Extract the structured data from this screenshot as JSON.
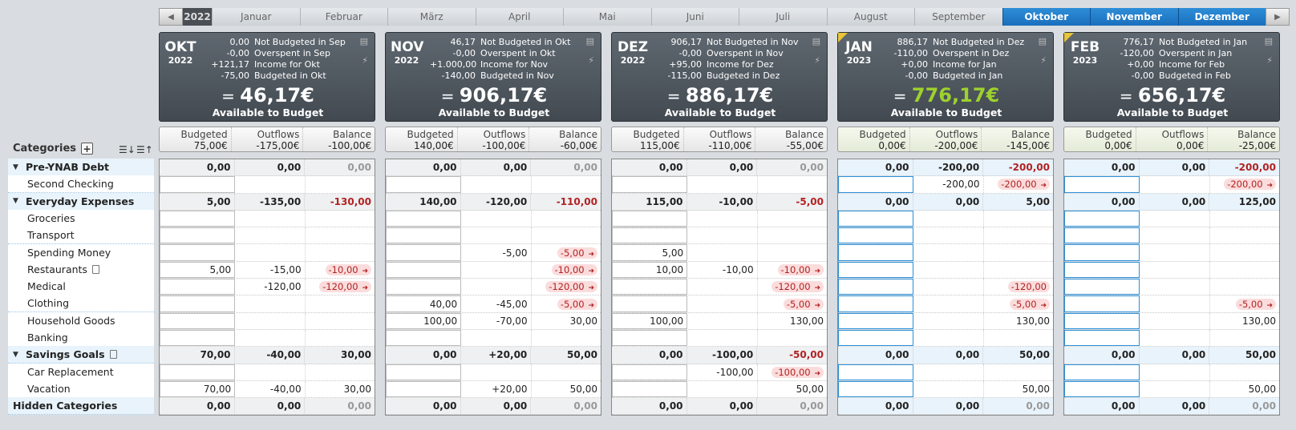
{
  "nav": {
    "prev_icon": "◀",
    "next_icon": "▶",
    "year": "2022",
    "months": [
      {
        "label": "Januar",
        "active": false
      },
      {
        "label": "Februar",
        "active": false
      },
      {
        "label": "März",
        "active": false
      },
      {
        "label": "April",
        "active": false
      },
      {
        "label": "Mai",
        "active": false
      },
      {
        "label": "Juni",
        "active": false
      },
      {
        "label": "Juli",
        "active": false
      },
      {
        "label": "August",
        "active": false
      },
      {
        "label": "September",
        "active": false
      },
      {
        "label": "Oktober",
        "active": true
      },
      {
        "label": "November",
        "active": true
      },
      {
        "label": "Dezember",
        "active": true
      }
    ]
  },
  "sidebar": {
    "title": "Categories",
    "add_icon": "+",
    "sort_icon_1": "☰↓",
    "sort_icon_2": "☰↑",
    "rows": [
      {
        "label": "Pre-YNAB Debt",
        "type": "grp"
      },
      {
        "label": "Second Checking",
        "type": "sub"
      },
      {
        "label": "Everyday Expenses",
        "type": "grp"
      },
      {
        "label": "Groceries",
        "type": "sub"
      },
      {
        "label": "Transport",
        "type": "sub"
      },
      {
        "label": "Spending Money",
        "type": "sub"
      },
      {
        "label": "Restaurants",
        "type": "sub",
        "note": true
      },
      {
        "label": "Medical",
        "type": "sub"
      },
      {
        "label": "Clothing",
        "type": "sub"
      },
      {
        "label": "Household Goods",
        "type": "sub"
      },
      {
        "label": "Banking",
        "type": "sub"
      },
      {
        "label": "Savings Goals",
        "type": "grp",
        "note": true
      },
      {
        "label": "Car Replacement",
        "type": "sub"
      },
      {
        "label": "Vacation",
        "type": "sub"
      },
      {
        "label": "Hidden Categories",
        "type": "hid"
      }
    ]
  },
  "months": [
    {
      "abbr": "OKT",
      "year": "2022",
      "current": false,
      "lines": [
        [
          "0,00",
          "Not Budgeted in Sep"
        ],
        [
          "-0,00",
          "Overspent in Sep"
        ],
        [
          "+121,17",
          "Income for Okt"
        ],
        [
          "-75,00",
          "Budgeted in Okt"
        ]
      ],
      "available": "46,17€",
      "available_label": "Available to Budget",
      "positive": false,
      "totals": {
        "budgeted_label": "Budgeted",
        "budgeted": "75,00€",
        "outflows_label": "Outflows",
        "outflows": "-175,00€",
        "balance_label": "Balance",
        "balance": "-100,00€"
      },
      "rows": [
        [
          "0,00",
          "0,00",
          "0,00",
          "gray"
        ],
        [
          "",
          "",
          "",
          ""
        ],
        [
          "5,00",
          "-135,00",
          "-130,00",
          "neg"
        ],
        [
          "",
          "",
          "",
          ""
        ],
        [
          "",
          "",
          "",
          ""
        ],
        [
          "",
          "",
          "",
          ""
        ],
        [
          "5,00",
          "-15,00",
          "-10,00",
          "pill"
        ],
        [
          "",
          "-120,00",
          "-120,00",
          "pill"
        ],
        [
          "",
          "",
          "",
          ""
        ],
        [
          "",
          "",
          "",
          ""
        ],
        [
          "",
          "",
          "",
          ""
        ],
        [
          "70,00",
          "-40,00",
          "30,00",
          ""
        ],
        [
          "",
          "",
          "",
          ""
        ],
        [
          "70,00",
          "-40,00",
          "30,00",
          ""
        ],
        [
          "0,00",
          "0,00",
          "0,00",
          "gray"
        ]
      ]
    },
    {
      "abbr": "NOV",
      "year": "2022",
      "current": false,
      "lines": [
        [
          "46,17",
          "Not Budgeted in Okt"
        ],
        [
          "-0,00",
          "Overspent in Okt"
        ],
        [
          "+1.000,00",
          "Income for Nov"
        ],
        [
          "-140,00",
          "Budgeted in Nov"
        ]
      ],
      "available": "906,17€",
      "available_label": "Available to Budget",
      "positive": false,
      "totals": {
        "budgeted_label": "Budgeted",
        "budgeted": "140,00€",
        "outflows_label": "Outflows",
        "outflows": "-100,00€",
        "balance_label": "Balance",
        "balance": "-60,00€"
      },
      "rows": [
        [
          "0,00",
          "0,00",
          "0,00",
          "gray"
        ],
        [
          "",
          "",
          "",
          ""
        ],
        [
          "140,00",
          "-120,00",
          "-110,00",
          "neg"
        ],
        [
          "",
          "",
          "",
          ""
        ],
        [
          "",
          "",
          "",
          ""
        ],
        [
          "",
          "-5,00",
          "-5,00",
          "pill"
        ],
        [
          "",
          "",
          "-10,00",
          "pill"
        ],
        [
          "",
          "",
          "-120,00",
          "pill"
        ],
        [
          "40,00",
          "-45,00",
          "-5,00",
          "pill"
        ],
        [
          "100,00",
          "-70,00",
          "30,00",
          ""
        ],
        [
          "",
          "",
          "",
          ""
        ],
        [
          "0,00",
          "+20,00",
          "50,00",
          ""
        ],
        [
          "",
          "",
          "",
          ""
        ],
        [
          "",
          "+20,00",
          "50,00",
          ""
        ],
        [
          "0,00",
          "0,00",
          "0,00",
          "gray"
        ]
      ]
    },
    {
      "abbr": "DEZ",
      "year": "2022",
      "current": false,
      "lines": [
        [
          "906,17",
          "Not Budgeted in Nov"
        ],
        [
          "-0,00",
          "Overspent in Nov"
        ],
        [
          "+95,00",
          "Income for Dez"
        ],
        [
          "-115,00",
          "Budgeted in Dez"
        ]
      ],
      "available": "886,17€",
      "available_label": "Available to Budget",
      "positive": false,
      "totals": {
        "budgeted_label": "Budgeted",
        "budgeted": "115,00€",
        "outflows_label": "Outflows",
        "outflows": "-110,00€",
        "balance_label": "Balance",
        "balance": "-55,00€"
      },
      "rows": [
        [
          "0,00",
          "0,00",
          "0,00",
          "gray"
        ],
        [
          "",
          "",
          "",
          ""
        ],
        [
          "115,00",
          "-10,00",
          "-5,00",
          "neg"
        ],
        [
          "",
          "",
          "",
          ""
        ],
        [
          "",
          "",
          "",
          ""
        ],
        [
          "5,00",
          "",
          "",
          ""
        ],
        [
          "10,00",
          "-10,00",
          "-10,00",
          "pill"
        ],
        [
          "",
          "",
          "-120,00",
          "pill"
        ],
        [
          "",
          "",
          "-5,00",
          "pill"
        ],
        [
          "100,00",
          "",
          "130,00",
          ""
        ],
        [
          "",
          "",
          "",
          ""
        ],
        [
          "0,00",
          "-100,00",
          "-50,00",
          "neg"
        ],
        [
          "",
          "-100,00",
          "-100,00",
          "pill"
        ],
        [
          "",
          "",
          "50,00",
          ""
        ],
        [
          "0,00",
          "0,00",
          "0,00",
          "gray"
        ]
      ]
    },
    {
      "abbr": "JAN",
      "year": "2023",
      "current": true,
      "lines": [
        [
          "886,17",
          "Not Budgeted in Dez"
        ],
        [
          "-110,00",
          "Overspent in Dez"
        ],
        [
          "+0,00",
          "Income for Jan"
        ],
        [
          "-0,00",
          "Budgeted in Jan"
        ]
      ],
      "available": "776,17€",
      "available_label": "Available to Budget",
      "positive": true,
      "totals": {
        "budgeted_label": "Budgeted",
        "budgeted": "0,00€",
        "outflows_label": "Outflows",
        "outflows": "-200,00€",
        "balance_label": "Balance",
        "balance": "-145,00€"
      },
      "rows": [
        [
          "0,00",
          "-200,00",
          "-200,00",
          "neg"
        ],
        [
          "",
          "-200,00",
          "-200,00",
          "pill"
        ],
        [
          "0,00",
          "0,00",
          "5,00",
          ""
        ],
        [
          "",
          "",
          "",
          ""
        ],
        [
          "",
          "",
          "",
          ""
        ],
        [
          "",
          "",
          "",
          ""
        ],
        [
          "",
          "",
          "",
          ""
        ],
        [
          "",
          "",
          "-120,00",
          "pill"
        ],
        [
          "",
          "",
          "-5,00",
          "pill"
        ],
        [
          "",
          "",
          "130,00",
          ""
        ],
        [
          "",
          "",
          "",
          ""
        ],
        [
          "0,00",
          "0,00",
          "50,00",
          ""
        ],
        [
          "",
          "",
          "",
          ""
        ],
        [
          "",
          "",
          "50,00",
          ""
        ],
        [
          "0,00",
          "0,00",
          "0,00",
          "gray"
        ]
      ]
    },
    {
      "abbr": "FEB",
      "year": "2023",
      "current": true,
      "lines": [
        [
          "776,17",
          "Not Budgeted in Jan"
        ],
        [
          "-120,00",
          "Overspent in Jan"
        ],
        [
          "+0,00",
          "Income for Feb"
        ],
        [
          "-0,00",
          "Budgeted in Feb"
        ]
      ],
      "available": "656,17€",
      "available_label": "Available to Budget",
      "positive": false,
      "totals": {
        "budgeted_label": "Budgeted",
        "budgeted": "0,00€",
        "outflows_label": "Outflows",
        "outflows": "0,00€",
        "balance_label": "Balance",
        "balance": "-25,00€"
      },
      "rows": [
        [
          "0,00",
          "0,00",
          "-200,00",
          "neg"
        ],
        [
          "",
          "",
          "-200,00",
          "pill"
        ],
        [
          "0,00",
          "0,00",
          "125,00",
          ""
        ],
        [
          "",
          "",
          "",
          ""
        ],
        [
          "",
          "",
          "",
          ""
        ],
        [
          "",
          "",
          "",
          ""
        ],
        [
          "",
          "",
          "",
          ""
        ],
        [
          "",
          "",
          "",
          ""
        ],
        [
          "",
          "",
          "-5,00",
          "pill"
        ],
        [
          "",
          "",
          "130,00",
          ""
        ],
        [
          "",
          "",
          "",
          ""
        ],
        [
          "0,00",
          "0,00",
          "50,00",
          ""
        ],
        [
          "",
          "",
          "",
          ""
        ],
        [
          "",
          "",
          "50,00",
          ""
        ],
        [
          "0,00",
          "0,00",
          "0,00",
          "gray"
        ]
      ]
    }
  ]
}
